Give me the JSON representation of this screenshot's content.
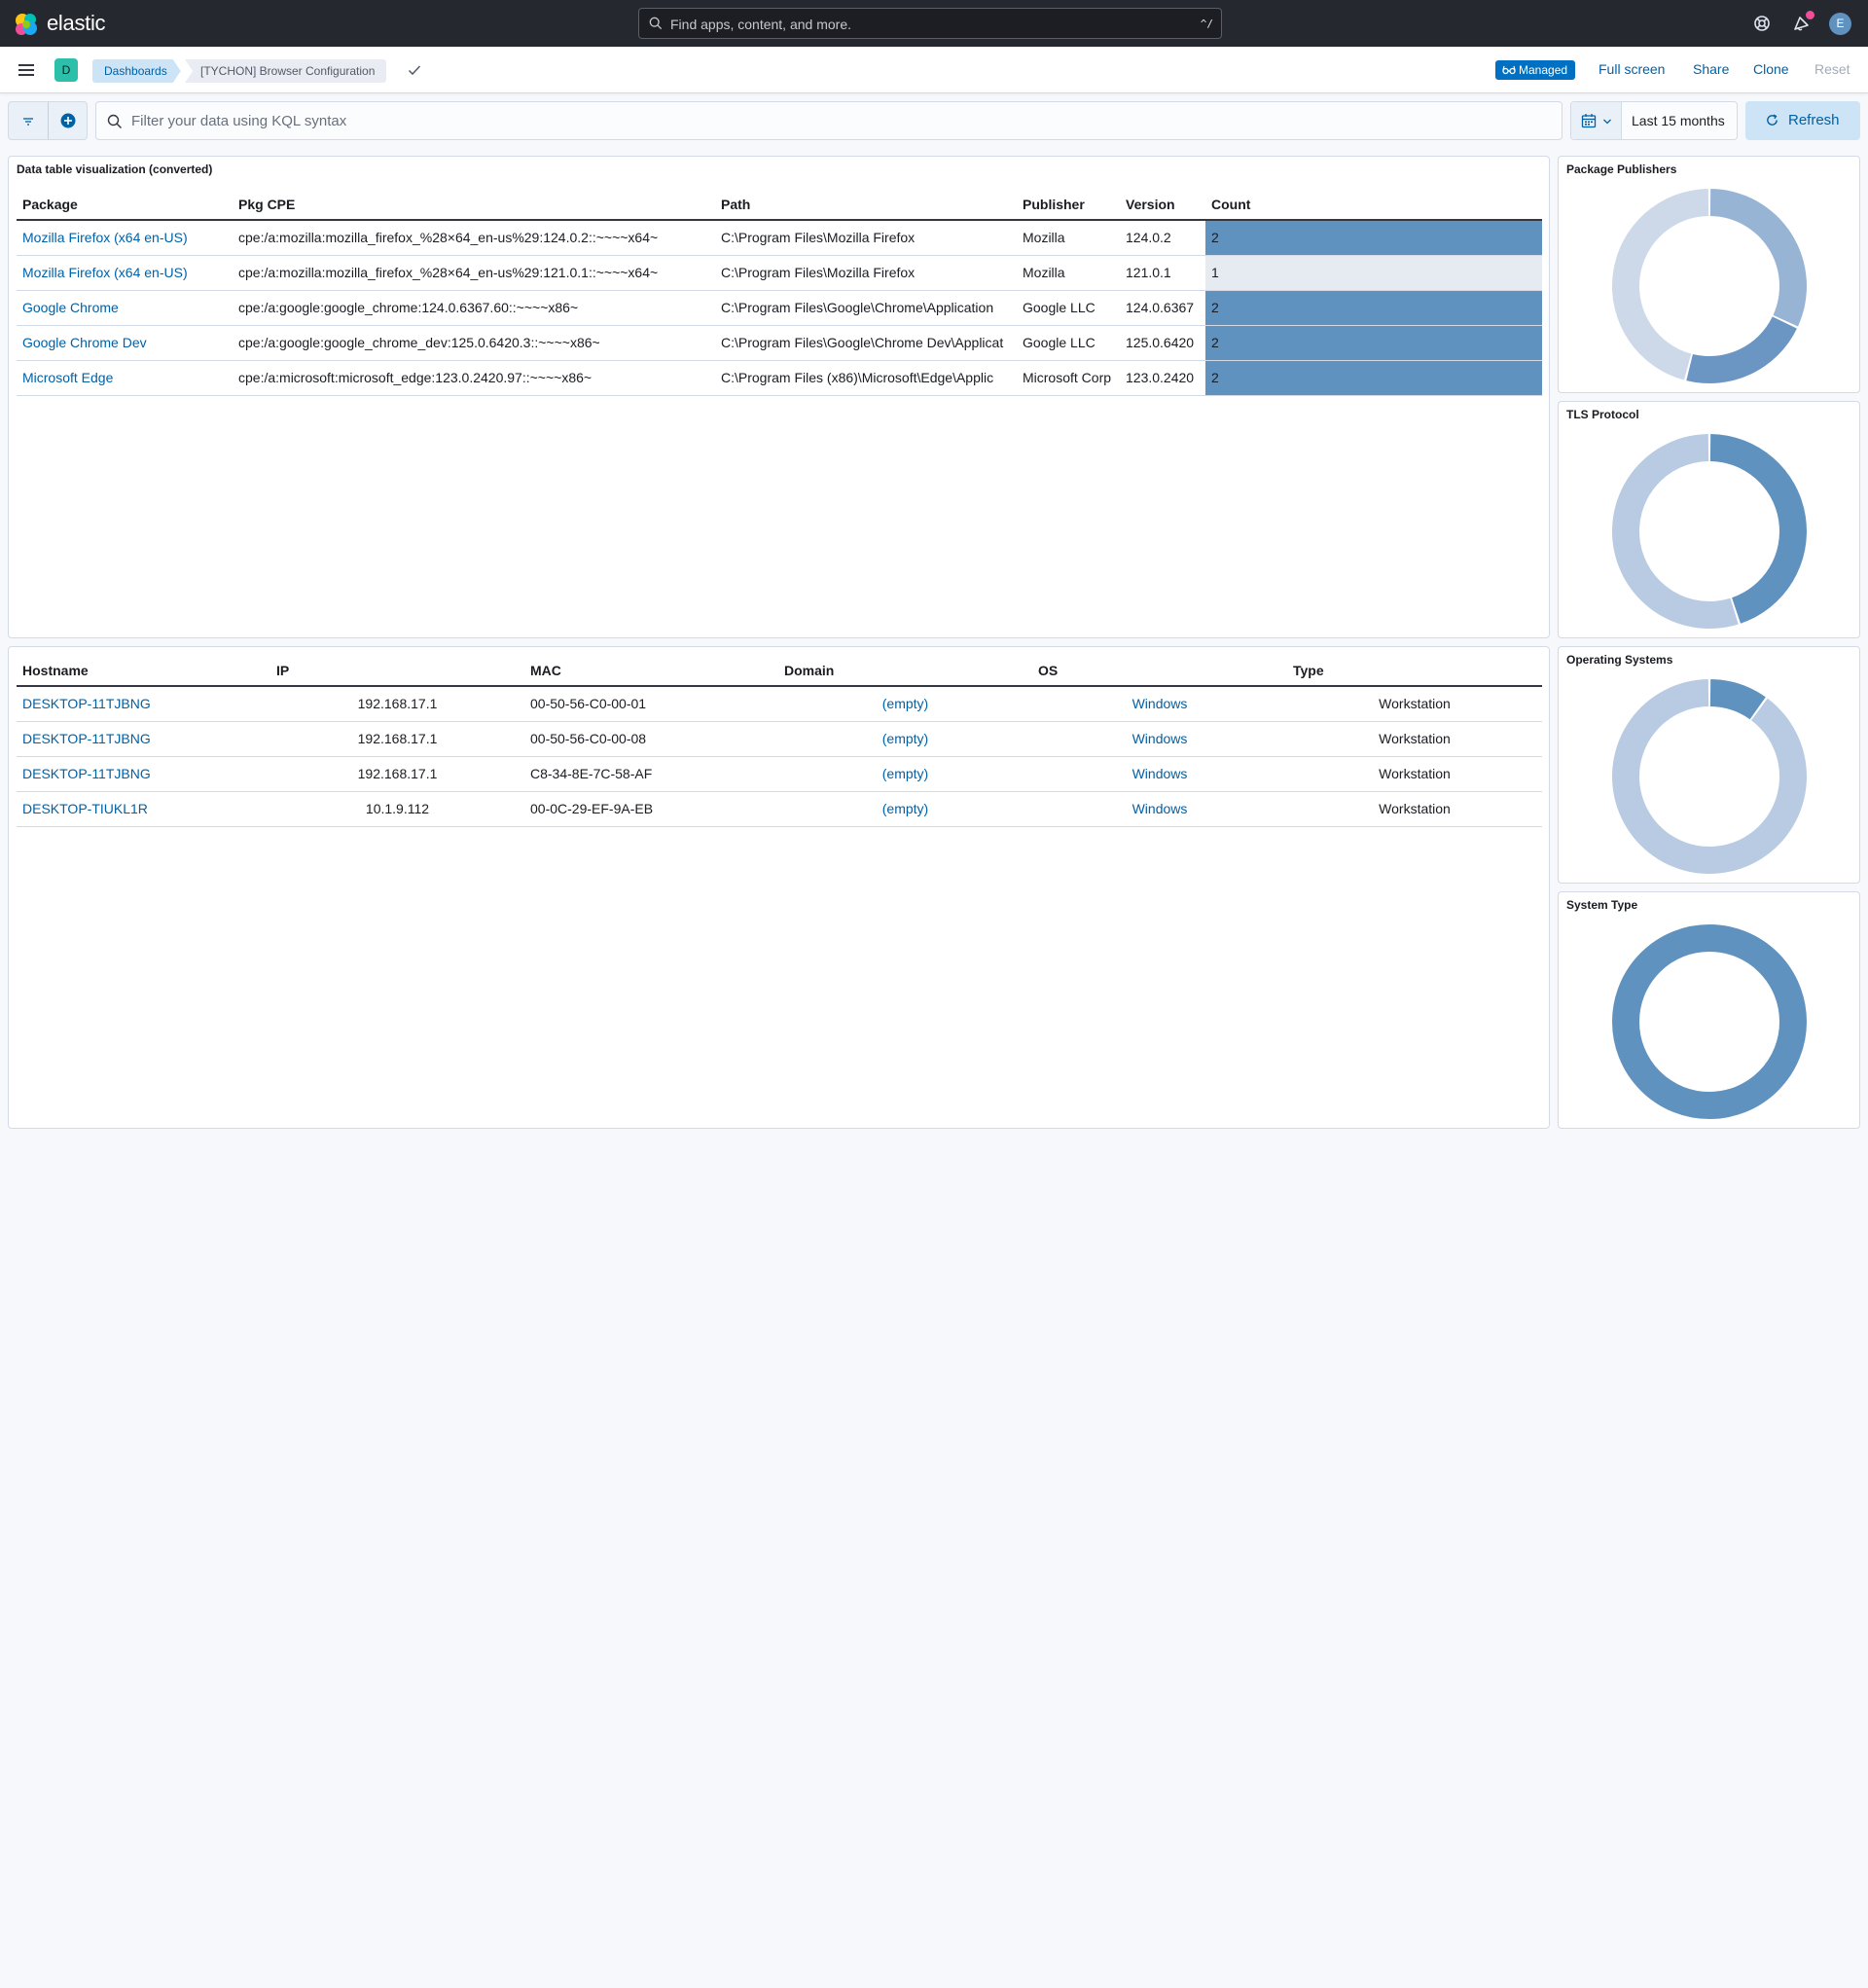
{
  "header": {
    "logo_text": "elastic",
    "search_placeholder": "Find apps, content, and more.",
    "search_shortcut": "^/",
    "avatar_initial": "E"
  },
  "appbar": {
    "space_initial": "D",
    "breadcrumb_root": "Dashboards",
    "breadcrumb_current": "[TYCHON] Browser Configuration",
    "managed_label": "Managed",
    "full_screen": "Full screen",
    "share": "Share",
    "clone": "Clone",
    "reset": "Reset"
  },
  "querybar": {
    "kql_placeholder": "Filter your data using KQL syntax",
    "time_range": "Last 15 months",
    "refresh_label": "Refresh"
  },
  "packages_panel": {
    "title": "Data table visualization (converted)",
    "columns": [
      "Package",
      "Pkg CPE",
      "Path",
      "Publisher",
      "Version",
      "Count"
    ],
    "rows": [
      [
        "Mozilla Firefox (x64 en-US)",
        "cpe:/a:mozilla:mozilla_firefox_%28×64_en-us%29:124.0.2::~~~~x64~",
        "C:\\Program Files\\Mozilla Firefox",
        "Mozilla",
        "124.0.2",
        "2"
      ],
      [
        "Mozilla Firefox (x64 en-US)",
        "cpe:/a:mozilla:mozilla_firefox_%28×64_en-us%29:121.0.1::~~~~x64~",
        "C:\\Program Files\\Mozilla Firefox",
        "Mozilla",
        "121.0.1",
        "1"
      ],
      [
        "Google Chrome",
        "cpe:/a:google:google_chrome:124.0.6367.60::~~~~x86~",
        "C:\\Program Files\\Google\\Chrome\\Application",
        "Google LLC",
        "124.0.6367",
        "2"
      ],
      [
        "Google Chrome Dev",
        "cpe:/a:google:google_chrome_dev:125.0.6420.3::~~~~x86~",
        "C:\\Program Files\\Google\\Chrome Dev\\Applicat",
        "Google LLC",
        "125.0.6420",
        "2"
      ],
      [
        "Microsoft Edge",
        "cpe:/a:microsoft:microsoft_edge:123.0.2420.97::~~~~x86~",
        "C:\\Program Files (x86)\\Microsoft\\Edge\\Applic",
        "Microsoft Corp",
        "123.0.2420",
        "2"
      ]
    ]
  },
  "hosts_panel": {
    "columns": [
      "Hostname",
      "IP",
      "MAC",
      "Domain",
      "OS",
      "Type"
    ],
    "rows": [
      [
        "DESKTOP-11TJBNG",
        "192.168.17.1",
        "00-50-56-C0-00-01",
        "(empty)",
        "Windows",
        "Workstation"
      ],
      [
        "DESKTOP-11TJBNG",
        "192.168.17.1",
        "00-50-56-C0-00-08",
        "(empty)",
        "Windows",
        "Workstation"
      ],
      [
        "DESKTOP-11TJBNG",
        "192.168.17.1",
        "C8-34-8E-7C-58-AF",
        "(empty)",
        "Windows",
        "Workstation"
      ],
      [
        "DESKTOP-TIUKL1R",
        "10.1.9.112",
        "00-0C-29-EF-9A-EB",
        "(empty)",
        "Windows",
        "Workstation"
      ]
    ]
  },
  "donuts": [
    {
      "title": "Package Publishers",
      "slices": [
        {
          "fraction": 0.32,
          "color": "#98b4d4"
        },
        {
          "fraction": 0.22,
          "color": "#6b96c3"
        },
        {
          "fraction": 0.46,
          "color": "#cdd9e9"
        }
      ]
    },
    {
      "title": "TLS Protocol",
      "slices": [
        {
          "fraction": 0.45,
          "color": "#6092c0"
        },
        {
          "fraction": 0.55,
          "color": "#b8cbe2"
        }
      ]
    },
    {
      "title": "Operating Systems",
      "slices": [
        {
          "fraction": 0.1,
          "color": "#6092c0"
        },
        {
          "fraction": 0.9,
          "color": "#b8cbe2"
        }
      ]
    },
    {
      "title": "System Type",
      "slices": [
        {
          "fraction": 1.0,
          "color": "#6092c0"
        }
      ]
    }
  ],
  "colors": {
    "link": "#0061a6",
    "count_high": "#6092c0",
    "count_low": "#e6ebf2",
    "header_bg": "#25282f"
  }
}
